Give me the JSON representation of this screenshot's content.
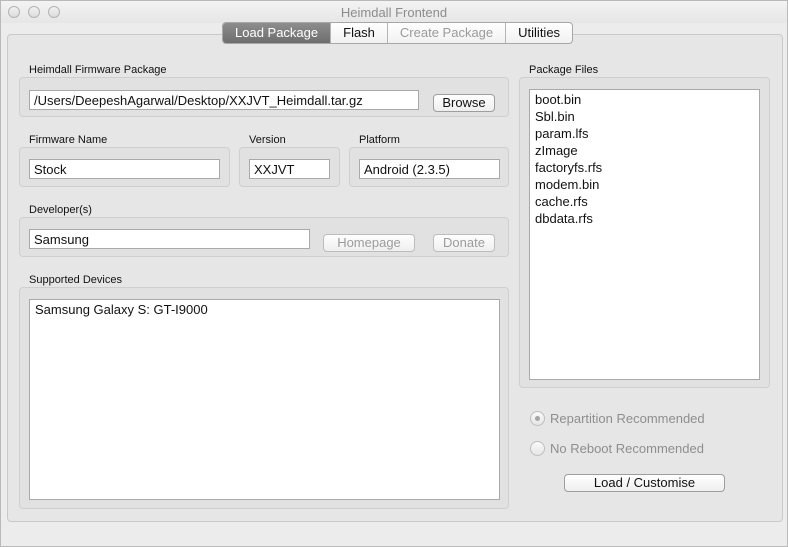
{
  "window": {
    "title": "Heimdall Frontend"
  },
  "tabs": [
    {
      "label": "Load Package",
      "active": true,
      "disabled": false
    },
    {
      "label": "Flash",
      "active": false,
      "disabled": false
    },
    {
      "label": "Create Package",
      "active": false,
      "disabled": true
    },
    {
      "label": "Utilities",
      "active": false,
      "disabled": false
    }
  ],
  "firmware_package": {
    "label": "Heimdall Firmware Package",
    "path": "/Users/DeepeshAgarwal/Desktop/XXJVT_Heimdall.tar.gz",
    "browse_label": "Browse"
  },
  "firmware_name": {
    "label": "Firmware Name",
    "value": "Stock"
  },
  "version": {
    "label": "Version",
    "value": "XXJVT"
  },
  "platform": {
    "label": "Platform",
    "value": "Android (2.3.5)"
  },
  "developers": {
    "label": "Developer(s)",
    "value": "Samsung",
    "homepage_label": "Homepage",
    "donate_label": "Donate"
  },
  "supported_devices": {
    "label": "Supported Devices",
    "items": [
      "Samsung Galaxy S: GT-I9000"
    ]
  },
  "package_files": {
    "label": "Package Files",
    "items": [
      "boot.bin",
      "Sbl.bin",
      "param.lfs",
      "zImage",
      "factoryfs.rfs",
      "modem.bin",
      "cache.rfs",
      "dbdata.rfs"
    ]
  },
  "options": {
    "repartition_label": "Repartition Recommended",
    "repartition_checked": true,
    "no_reboot_label": "No Reboot Recommended",
    "no_reboot_checked": false
  },
  "load_button_label": "Load / Customise"
}
